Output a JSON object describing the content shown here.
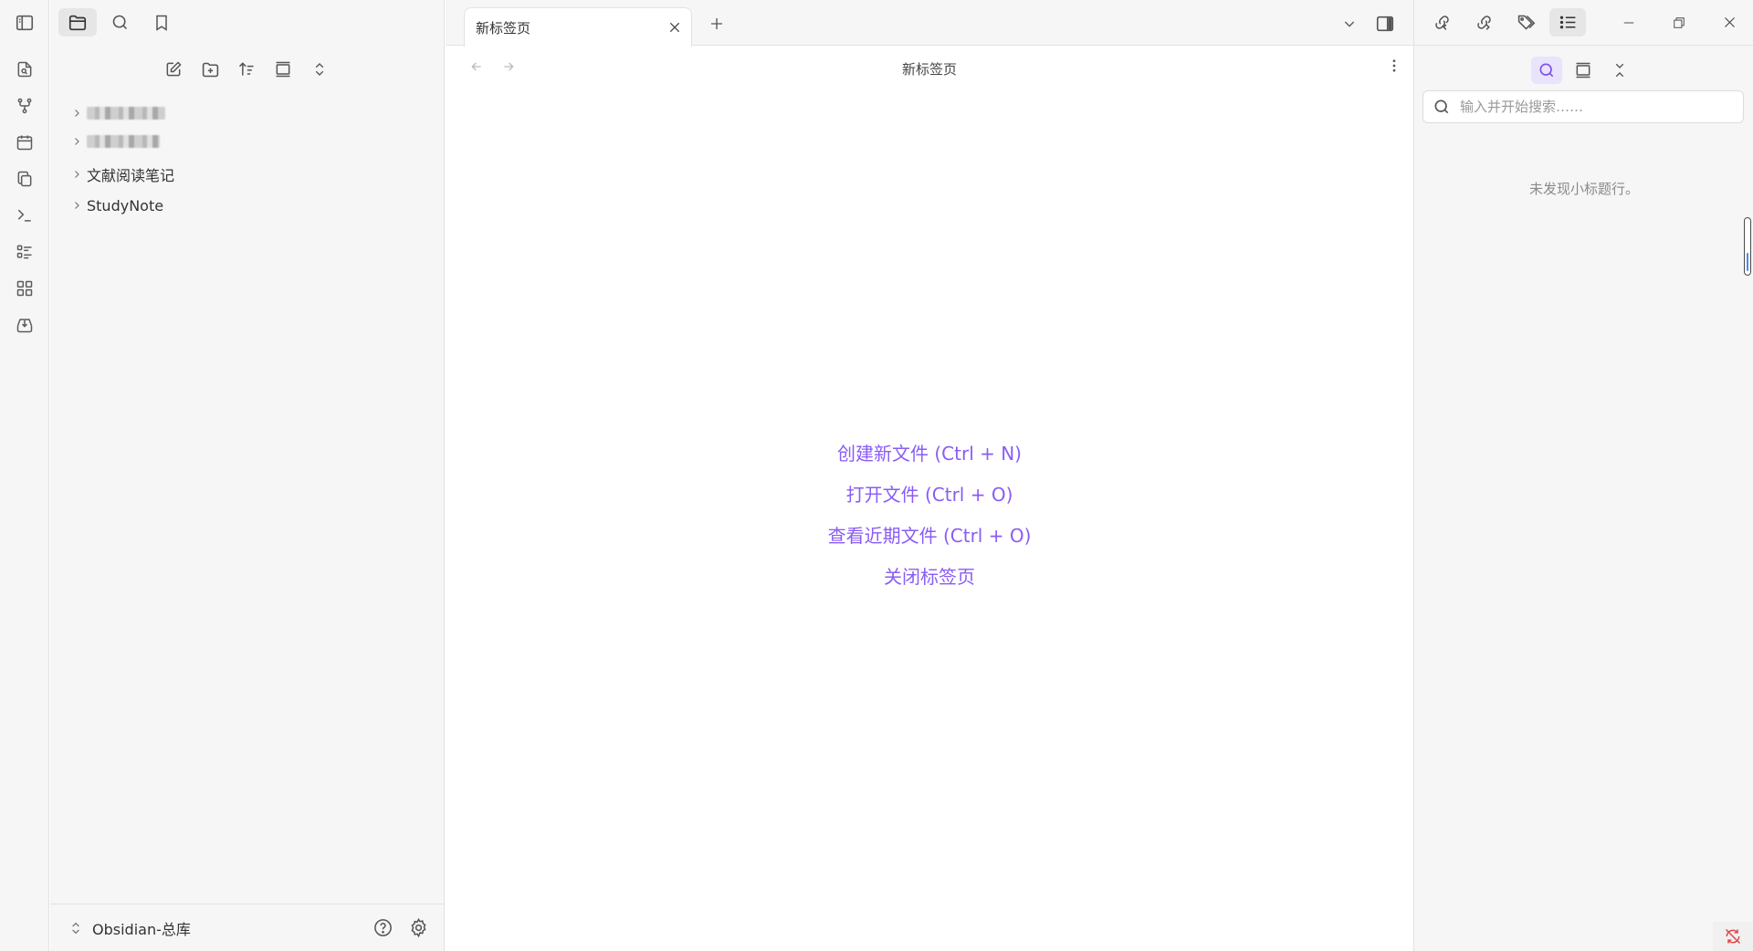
{
  "tabs": [
    {
      "title": "新标签页"
    }
  ],
  "main": {
    "view_title": "新标签页",
    "actions": [
      {
        "label": "创建新文件 (Ctrl + N)"
      },
      {
        "label": "打开文件 (Ctrl + O)"
      },
      {
        "label": "查看近期文件 (Ctrl + O)"
      },
      {
        "label": "关闭标签页"
      }
    ]
  },
  "file_tree": {
    "items": [
      {
        "label": "",
        "redacted": true
      },
      {
        "label": "",
        "redacted": true
      },
      {
        "label": "文献阅读笔记"
      },
      {
        "label": "StudyNote"
      }
    ]
  },
  "vault": {
    "name": "Obsidian-总库"
  },
  "outline": {
    "search_placeholder": "输入并开始搜索……",
    "empty_message": "未发现小标题行。"
  },
  "colors": {
    "accent": "#8a5cf5",
    "sidebar_bg": "#f6f6f6",
    "border": "#e2e2e2",
    "sync_error": "#e04545"
  }
}
